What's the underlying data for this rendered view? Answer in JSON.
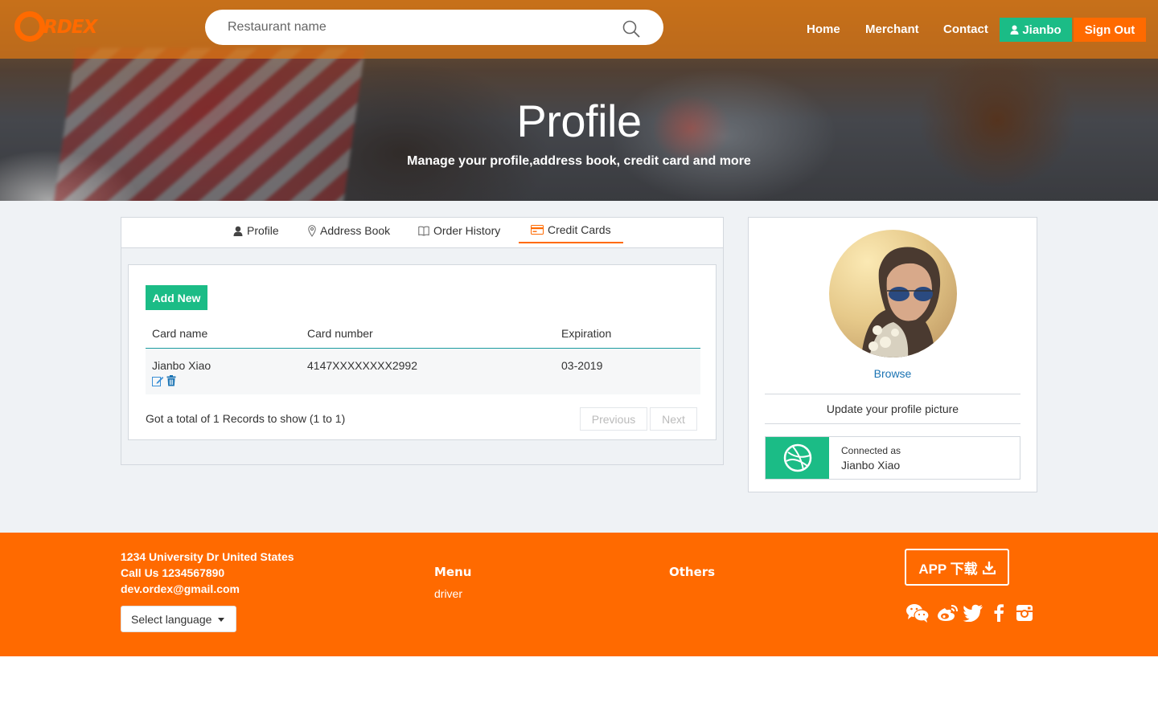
{
  "brand": {
    "logo_text": "RDEX",
    "accent": "#ff6a00",
    "green": "#1bbc86"
  },
  "search": {
    "placeholder": "Restaurant name",
    "icon": "search-icon"
  },
  "nav": {
    "home": "Home",
    "merchant": "Merchant",
    "contact": "Contact",
    "user": "Jianbo",
    "sign_out": "Sign Out"
  },
  "hero": {
    "title": "Profile",
    "subtitle": "Manage your profile,address book, credit card and more"
  },
  "tabs": [
    {
      "label": "Profile",
      "icon": "user-icon"
    },
    {
      "label": "Address Book",
      "icon": "map-pin-icon"
    },
    {
      "label": "Order History",
      "icon": "book-icon"
    },
    {
      "label": "Credit Cards",
      "icon": "credit-card-icon",
      "active": true
    }
  ],
  "cards_table": {
    "add_label": "Add New",
    "headers": [
      "Card name",
      "Card number",
      "Expiration"
    ],
    "rows": [
      {
        "name": "Jianbo Xiao",
        "number": "4147XXXXXXXX2992",
        "expiration": "03-2019"
      }
    ],
    "summary": "Got a total of 1 Records to show (1 to 1)",
    "prev_label": "Previous",
    "next_label": "Next"
  },
  "sidebar": {
    "browse": "Browse",
    "update_text": "Update your profile picture",
    "connected_label": "Connected as",
    "connected_name": "Jianbo Xiao",
    "connected_icon": "dribbble-icon"
  },
  "footer": {
    "address": "1234 University Dr United States",
    "phone": "Call Us 1234567890",
    "email": "dev.ordex@gmail.com",
    "language": "Select language",
    "menu_heading": "Menu",
    "menu_links": [
      "driver"
    ],
    "others_heading": "Others",
    "app_button": "APP 下载",
    "social": [
      "wechat-icon",
      "weibo-icon",
      "twitter-icon",
      "facebook-icon",
      "instagram-icon"
    ]
  }
}
